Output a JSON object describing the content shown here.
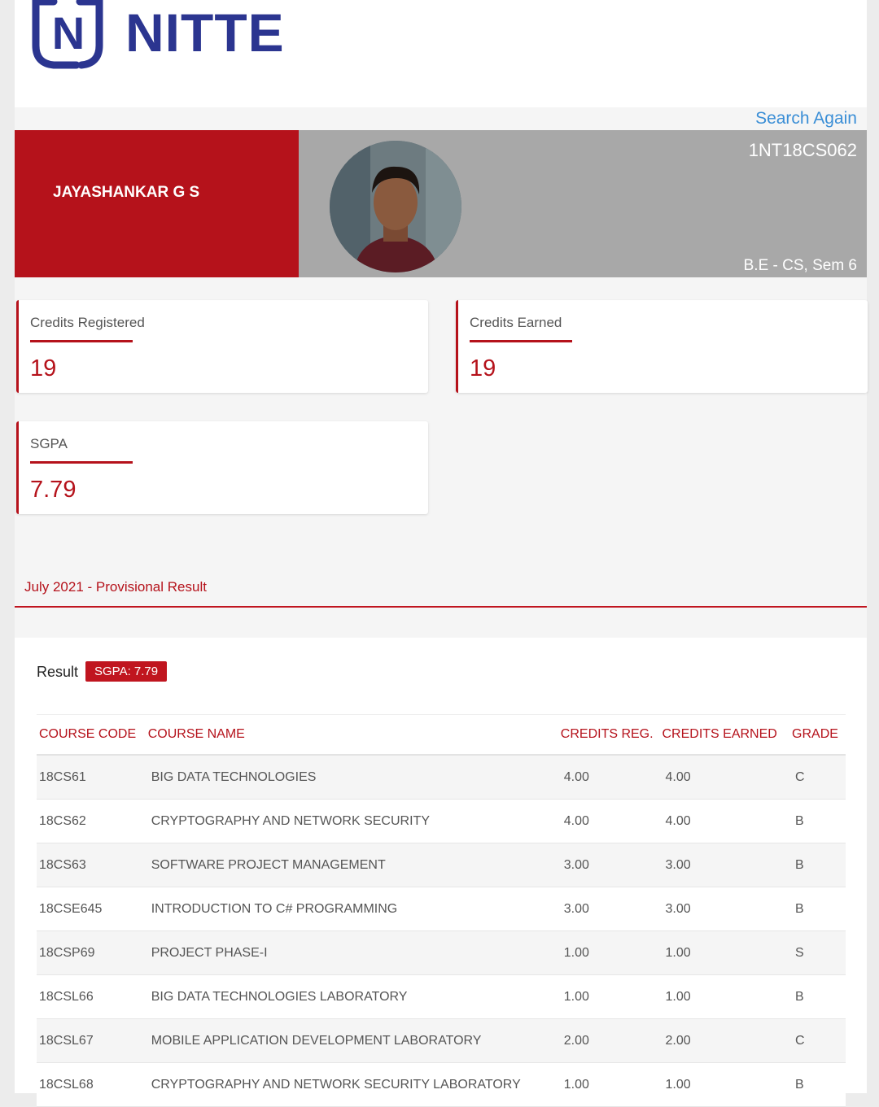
{
  "brand": {
    "name": "NITTE",
    "mark_letter": "N",
    "color": "#2b3590"
  },
  "header": {
    "search_again_label": "Search Again"
  },
  "student": {
    "name": "JAYASHANKAR G S",
    "usn": "1NT18CS062",
    "program": "B.E - CS, Sem 6",
    "photo": "student-photo"
  },
  "stats": {
    "credits_registered": {
      "label": "Credits Registered",
      "value": "19"
    },
    "credits_earned": {
      "label": "Credits Earned",
      "value": "19"
    },
    "sgpa": {
      "label": "SGPA",
      "value": "7.79"
    }
  },
  "result_period": "July 2021 - Provisional Result",
  "result": {
    "label": "Result",
    "badge": "SGPA: 7.79",
    "columns": [
      "COURSE CODE",
      "COURSE NAME",
      "CREDITS REG.",
      "CREDITS EARNED",
      "GRADE"
    ],
    "rows": [
      {
        "code": "18CS61",
        "name": "BIG DATA TECHNOLOGIES",
        "reg": "4.00",
        "earned": "4.00",
        "grade": "C"
      },
      {
        "code": "18CS62",
        "name": "CRYPTOGRAPHY AND NETWORK SECURITY",
        "reg": "4.00",
        "earned": "4.00",
        "grade": "B"
      },
      {
        "code": "18CS63",
        "name": "SOFTWARE PROJECT MANAGEMENT",
        "reg": "3.00",
        "earned": "3.00",
        "grade": "B"
      },
      {
        "code": "18CSE645",
        "name": "INTRODUCTION TO C# PROGRAMMING",
        "reg": "3.00",
        "earned": "3.00",
        "grade": "B"
      },
      {
        "code": "18CSP69",
        "name": "PROJECT PHASE-I",
        "reg": "1.00",
        "earned": "1.00",
        "grade": "S"
      },
      {
        "code": "18CSL66",
        "name": "BIG DATA TECHNOLOGIES LABORATORY",
        "reg": "1.00",
        "earned": "1.00",
        "grade": "B"
      },
      {
        "code": "18CSL67",
        "name": "MOBILE APPLICATION DEVELOPMENT LABORATORY",
        "reg": "2.00",
        "earned": "2.00",
        "grade": "C"
      },
      {
        "code": "18CSL68",
        "name": "CRYPTOGRAPHY AND NETWORK SECURITY LABORATORY",
        "reg": "1.00",
        "earned": "1.00",
        "grade": "B"
      }
    ]
  },
  "colors": {
    "accent": "#b5121b",
    "link": "#3a8ed6",
    "band_gray": "#a8a8a8"
  }
}
